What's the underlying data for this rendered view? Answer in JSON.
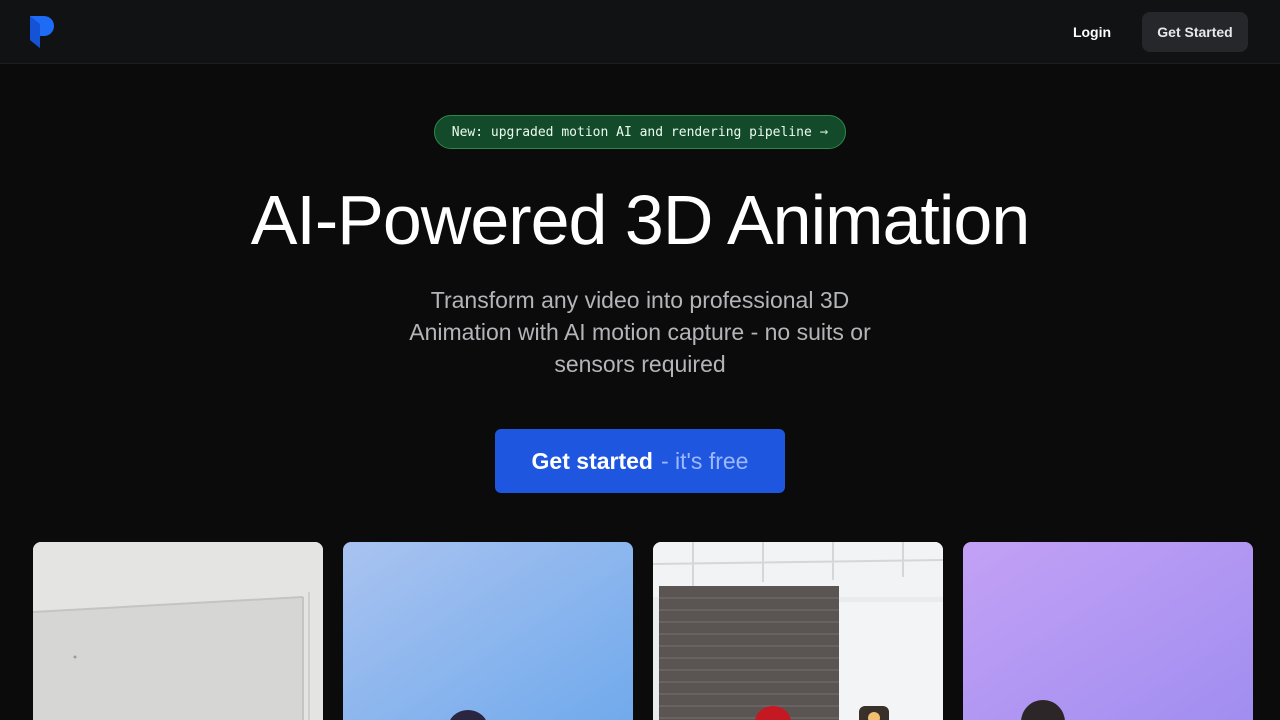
{
  "nav": {
    "login_label": "Login",
    "get_started_label": "Get Started",
    "logo_icon": "brand-logo-icon"
  },
  "announcement": {
    "text": "New: upgraded motion AI and rendering pipeline",
    "arrow": "→"
  },
  "hero": {
    "title": "AI-Powered 3D Animation",
    "subtitle": "Transform any video into professional 3D Animation with AI motion capture - no suits or sensors required",
    "cta_primary": "Get started",
    "cta_secondary": "- it's free"
  },
  "colors": {
    "background": "#0b0b0c",
    "navbar": "#111214",
    "accent_blue": "#1f56e0",
    "announce_green": "#134a2a",
    "announce_border": "#2a8a4c"
  },
  "gallery": {
    "cards": [
      {
        "name": "video-thumbnail-white-room"
      },
      {
        "name": "video-thumbnail-blue-sky"
      },
      {
        "name": "video-thumbnail-brick-wall"
      },
      {
        "name": "video-thumbnail-purple-backdrop"
      }
    ]
  }
}
